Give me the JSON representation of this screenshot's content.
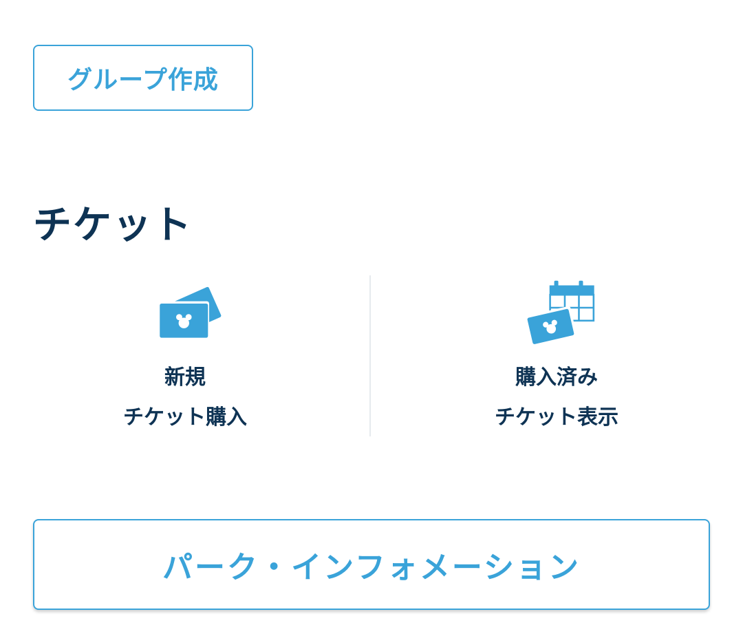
{
  "group_button": {
    "label": "グループ作成"
  },
  "ticket_section": {
    "title": "チケット",
    "items": [
      {
        "line1": "新規",
        "line2": "チケット購入",
        "icon": "tickets-icon"
      },
      {
        "line1": "購入済み",
        "line2": "チケット表示",
        "icon": "calendar-ticket-icon"
      }
    ]
  },
  "info_button": {
    "label": "パーク・インフォメーション"
  },
  "colors": {
    "accent": "#3aa3d9",
    "heading": "#0e3354",
    "divider": "#e6eaee"
  }
}
